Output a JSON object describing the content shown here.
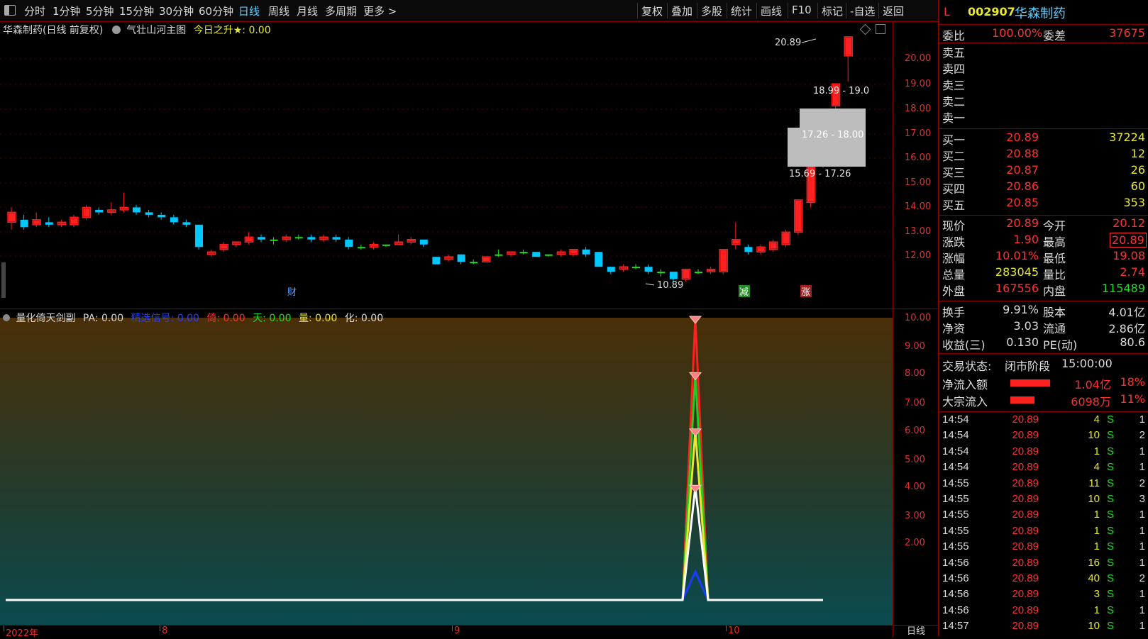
{
  "toolbar": {
    "left_items": [
      "分时",
      "1分钟",
      "5分钟",
      "15分钟",
      "30分钟",
      "60分钟",
      "日线",
      "周线",
      "月线",
      "多周期",
      "更多 >"
    ],
    "active": "日线",
    "right_items": [
      "复权",
      "叠加",
      "多股",
      "统计",
      "画线",
      "F10",
      "标记",
      "-自选",
      "返回"
    ]
  },
  "main": {
    "title": "华森制药(日线 前复权)",
    "indicator": "气壮山河主图",
    "indicator_value": "今日之升★: 0.00",
    "price_ticks": [
      "20.00",
      "19.00",
      "18.00",
      "17.00",
      "16.00",
      "15.00",
      "14.00",
      "13.00",
      "12.00"
    ],
    "annotations": {
      "high": "20.89",
      "low": "10.89",
      "zone1": "18.99 - 19.0",
      "zone2": "17.26 - 18.00",
      "zone3": "15.69 - 17.26"
    },
    "markers": {
      "cai": "财",
      "jian": "减",
      "zhang": "涨"
    }
  },
  "sub": {
    "title": "量化倚天剑副",
    "pa": "PA: 0.00",
    "signal": "精选信号: 0.00",
    "yi": "倚: 0.00",
    "tian": "天: 0.00",
    "liang": "量: 0.00",
    "hua": "化: 0.00",
    "ticks": [
      "10.00",
      "9.00",
      "8.00",
      "7.00",
      "6.00",
      "5.00",
      "4.00",
      "3.00",
      "2.00"
    ]
  },
  "bottom_axis": {
    "labels": [
      "2022年",
      "8",
      "9",
      "10"
    ],
    "period": "日线"
  },
  "panel": {
    "flag": "L",
    "code": "002907",
    "name": "华森制药",
    "weibi_label": "委比",
    "weibi": "100.00%",
    "weicha_label": "委差",
    "weicha": "37675",
    "sell_labels": [
      "卖五",
      "卖四",
      "卖三",
      "卖二",
      "卖一"
    ],
    "buys": [
      {
        "label": "买一",
        "price": "20.89",
        "vol": "37224"
      },
      {
        "label": "买二",
        "price": "20.88",
        "vol": "12"
      },
      {
        "label": "买三",
        "price": "20.87",
        "vol": "26"
      },
      {
        "label": "买四",
        "price": "20.86",
        "vol": "60"
      },
      {
        "label": "买五",
        "price": "20.85",
        "vol": "353"
      }
    ],
    "stats": [
      {
        "l1": "现价",
        "v1": "20.89",
        "c1": "red",
        "l2": "今开",
        "v2": "20.12",
        "c2": "red"
      },
      {
        "l1": "涨跌",
        "v1": "1.90",
        "c1": "red",
        "l2": "最高",
        "v2": "20.89",
        "c2": "red"
      },
      {
        "l1": "涨幅",
        "v1": "10.01%",
        "c1": "red",
        "l2": "最低",
        "v2": "19.08",
        "c2": "red"
      },
      {
        "l1": "总量",
        "v1": "283045",
        "c1": "yellow",
        "l2": "量比",
        "v2": "2.74",
        "c2": "red"
      },
      {
        "l1": "外盘",
        "v1": "167556",
        "c1": "red",
        "l2": "内盘",
        "v2": "115489",
        "c2": "green"
      }
    ],
    "fund": [
      {
        "l1": "换手",
        "v1": "9.91%",
        "l2": "股本",
        "v2": "4.01亿"
      },
      {
        "l1": "净资",
        "v1": "3.03",
        "l2": "流通",
        "v2": "2.86亿"
      },
      {
        "l1": "收益(三)",
        "v1": "0.130",
        "l2": "PE(动)",
        "v2": "80.6"
      }
    ],
    "trade_state_label": "交易状态:",
    "trade_state": "闭市阶段",
    "trade_time": "15:00:00",
    "flows": [
      {
        "label": "净流入额",
        "value": "1.04亿",
        "pct": "18%",
        "fill": 0.18
      },
      {
        "label": "大宗流入",
        "value": "6098万",
        "pct": "11%",
        "fill": 0.11
      }
    ],
    "ticks": [
      {
        "t": "14:54",
        "p": "20.89",
        "v": "4",
        "s": "S",
        "n": "1"
      },
      {
        "t": "14:54",
        "p": "20.89",
        "v": "10",
        "s": "S",
        "n": "2"
      },
      {
        "t": "14:54",
        "p": "20.89",
        "v": "1",
        "s": "S",
        "n": "1"
      },
      {
        "t": "14:54",
        "p": "20.89",
        "v": "4",
        "s": "S",
        "n": "1"
      },
      {
        "t": "14:55",
        "p": "20.89",
        "v": "11",
        "s": "S",
        "n": "2"
      },
      {
        "t": "14:55",
        "p": "20.89",
        "v": "10",
        "s": "S",
        "n": "3"
      },
      {
        "t": "14:55",
        "p": "20.89",
        "v": "1",
        "s": "S",
        "n": "1"
      },
      {
        "t": "14:55",
        "p": "20.89",
        "v": "1",
        "s": "S",
        "n": "1"
      },
      {
        "t": "14:55",
        "p": "20.89",
        "v": "1",
        "s": "S",
        "n": "1"
      },
      {
        "t": "14:56",
        "p": "20.89",
        "v": "16",
        "s": "S",
        "n": "1"
      },
      {
        "t": "14:56",
        "p": "20.89",
        "v": "40",
        "s": "S",
        "n": "2"
      },
      {
        "t": "14:56",
        "p": "20.89",
        "v": "3",
        "s": "S",
        "n": "1"
      },
      {
        "t": "14:56",
        "p": "20.89",
        "v": "1",
        "s": "S",
        "n": "1"
      },
      {
        "t": "14:57",
        "p": "20.89",
        "v": "10",
        "s": "S",
        "n": "1"
      }
    ]
  },
  "colors": {
    "up": "#ff2020",
    "down": "#00c8ff",
    "flat": "#22dd22",
    "border": "#8a0000"
  }
}
